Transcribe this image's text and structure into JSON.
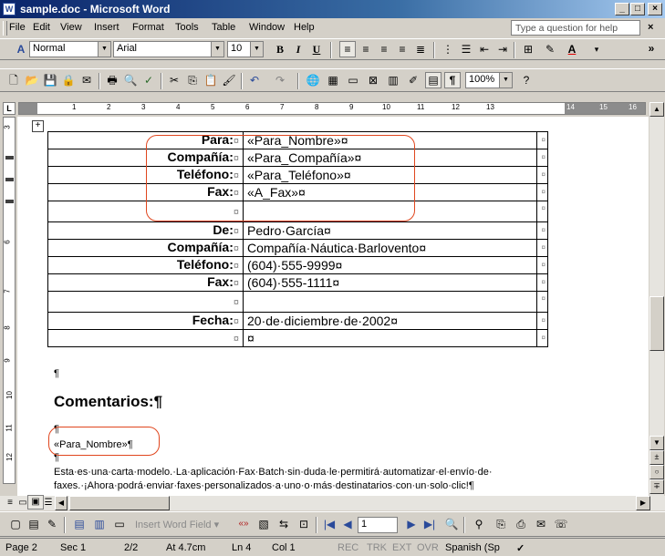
{
  "window": {
    "title": "sample.doc - Microsoft Word",
    "app_icon": "W",
    "min": "_",
    "max": "□",
    "close": "×"
  },
  "menu": {
    "items": [
      "File",
      "Edit",
      "View",
      "Insert",
      "Format",
      "Tools",
      "Table",
      "Window",
      "Help"
    ],
    "help_placeholder": "Type a question for help",
    "close_doc": "×"
  },
  "formatting": {
    "style": "Normal",
    "font": "Arial",
    "size": "10",
    "bold": "B",
    "italic": "I",
    "underline": "U",
    "more": "»"
  },
  "standard": {
    "zoom": "100%",
    "pilcrow": "¶"
  },
  "ruler": {
    "numbers": [
      "1",
      "2",
      "3",
      "4",
      "5",
      "6",
      "7",
      "8",
      "9",
      "10",
      "11",
      "12",
      "13",
      "14",
      "15",
      "16"
    ],
    "corner": "L"
  },
  "vruler": {
    "numbers": [
      "3",
      "1",
      "2",
      "3",
      "4",
      "5",
      "6",
      "7",
      "8",
      "9",
      "10",
      "11",
      "12"
    ]
  },
  "document": {
    "table_anchor": "+",
    "rows": [
      {
        "label": "Para:",
        "value": "«Para_Nombre»¤"
      },
      {
        "label": "Compañía:",
        "value": "«Para_Compañía»¤"
      },
      {
        "label": "Teléfono:",
        "value": "«Para_Teléfono»¤"
      },
      {
        "label": "Fax:",
        "value": "«A_Fax»¤"
      },
      {
        "label": "",
        "value": ""
      },
      {
        "label": "De:",
        "value": "Pedro·García¤"
      },
      {
        "label": "Compañía:",
        "value": "Compañía·Náutica·Barlovento¤"
      },
      {
        "label": "Teléfono:",
        "value": "(604)·555-9999¤"
      },
      {
        "label": "Fax:",
        "value": "(604)·555-1111¤"
      },
      {
        "label": "",
        "value": ""
      },
      {
        "label": "Fecha:",
        "value": "20·de·diciembre·de·2002¤"
      },
      {
        "label": "",
        "value": "¤"
      }
    ],
    "cell_mark": "¤",
    "label_mark": "¤",
    "pilcrow": "¶",
    "heading": "Comentarios:¶",
    "merge_field": "«Para_Nombre»¶",
    "body_line1": "Esta·es·una·carta·modelo.·La·aplicación·Fax·Batch·sin·duda·le·permitirá·automatizar·el·envío·de·",
    "body_line2": "faxes.·¡Ahora·podrá·enviar·faxes·personalizados·a·uno·o·más·destinatarios·con·un·solo·clic!¶"
  },
  "mailmerge": {
    "insert_word_field": "Insert Word Field ▾",
    "record": "1"
  },
  "status": {
    "page": "Page 2",
    "sec": "Sec 1",
    "pages": "2/2",
    "at": "At 4.7cm",
    "ln": "Ln 4",
    "col": "Col 1",
    "rec": "REC",
    "trk": "TRK",
    "ext": "EXT",
    "ovr": "OVR",
    "lang": "Spanish (Sp"
  },
  "colors": {
    "annotation": "#e0461e",
    "titlebar": "#0a246a"
  }
}
